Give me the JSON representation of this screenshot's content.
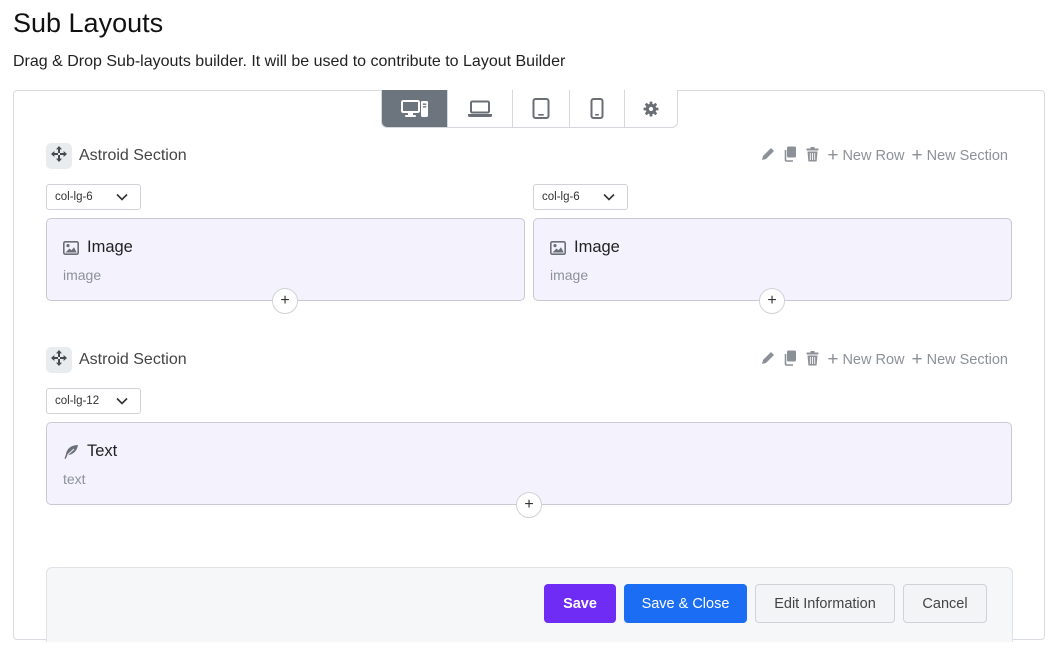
{
  "page": {
    "title": "Sub Layouts",
    "subtitle": "Drag & Drop Sub-layouts builder. It will be used to contribute to Layout Builder"
  },
  "device_bar": {
    "items": [
      "desktop-icon",
      "laptop-icon",
      "tablet-icon",
      "mobile-icon",
      "gear-icon"
    ],
    "active": "desktop-icon"
  },
  "sections": [
    {
      "name": "Astroid Section",
      "tools": {
        "new_row": "New Row",
        "new_section": "New Section"
      },
      "columns": [
        {
          "size": "col-lg-6",
          "element": {
            "title": "Image",
            "type": "image",
            "icon": "image-icon"
          }
        },
        {
          "size": "col-lg-6",
          "element": {
            "title": "Image",
            "type": "image",
            "icon": "image-icon"
          }
        }
      ]
    },
    {
      "name": "Astroid Section",
      "tools": {
        "new_row": "New Row",
        "new_section": "New Section"
      },
      "columns": [
        {
          "size": "col-lg-12",
          "element": {
            "title": "Text",
            "type": "text",
            "icon": "feather-icon"
          }
        }
      ]
    }
  ],
  "add_symbol": "+",
  "footer": {
    "save": "Save",
    "save_close": "Save & Close",
    "edit_info": "Edit Information",
    "cancel": "Cancel"
  },
  "colors": {
    "save": "#6f2cf4",
    "save_close": "#1b6ef3",
    "device_active": "#6c757d",
    "element_bg": "#f4f2fd"
  }
}
